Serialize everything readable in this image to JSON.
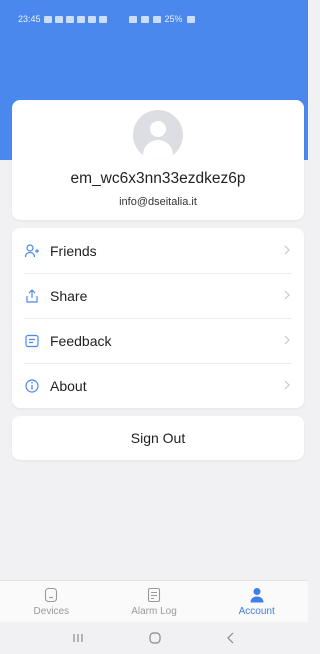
{
  "status_bar": {
    "time": "23:45",
    "battery": "25%"
  },
  "profile": {
    "username": "em_wc6x3nn33ezdkez6p",
    "email": "info@dseitalia.it"
  },
  "menu": {
    "items": [
      {
        "label": "Friends",
        "icon": "friends-icon"
      },
      {
        "label": "Share",
        "icon": "share-icon"
      },
      {
        "label": "Feedback",
        "icon": "feedback-icon"
      },
      {
        "label": "About",
        "icon": "info-icon"
      }
    ]
  },
  "sign_out_label": "Sign Out",
  "tabs": [
    {
      "label": "Devices",
      "icon": "devices-icon",
      "active": false
    },
    {
      "label": "Alarm Log",
      "icon": "alarm-log-icon",
      "active": false
    },
    {
      "label": "Account",
      "icon": "account-icon",
      "active": true
    }
  ],
  "colors": {
    "accent": "#4a88ee",
    "background": "#f1f1f3",
    "active_tab": "#3f7ee8"
  }
}
